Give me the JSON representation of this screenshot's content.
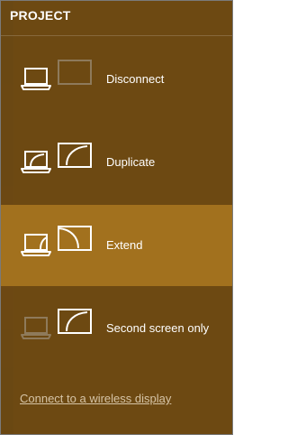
{
  "panel": {
    "title": "PROJECT"
  },
  "options": [
    {
      "label": "Disconnect",
      "icon": "disconnect-icon",
      "selected": false
    },
    {
      "label": "Duplicate",
      "icon": "duplicate-icon",
      "selected": false
    },
    {
      "label": "Extend",
      "icon": "extend-icon",
      "selected": true
    },
    {
      "label": "Second screen only",
      "icon": "second-screen-only-icon",
      "selected": false
    }
  ],
  "footer": {
    "wireless_link": "Connect to a wireless display"
  },
  "colors": {
    "panel_bg": "#6d4912",
    "selected_bg": "#a2711e",
    "text": "#ffffff",
    "link": "#d6c4a6"
  }
}
